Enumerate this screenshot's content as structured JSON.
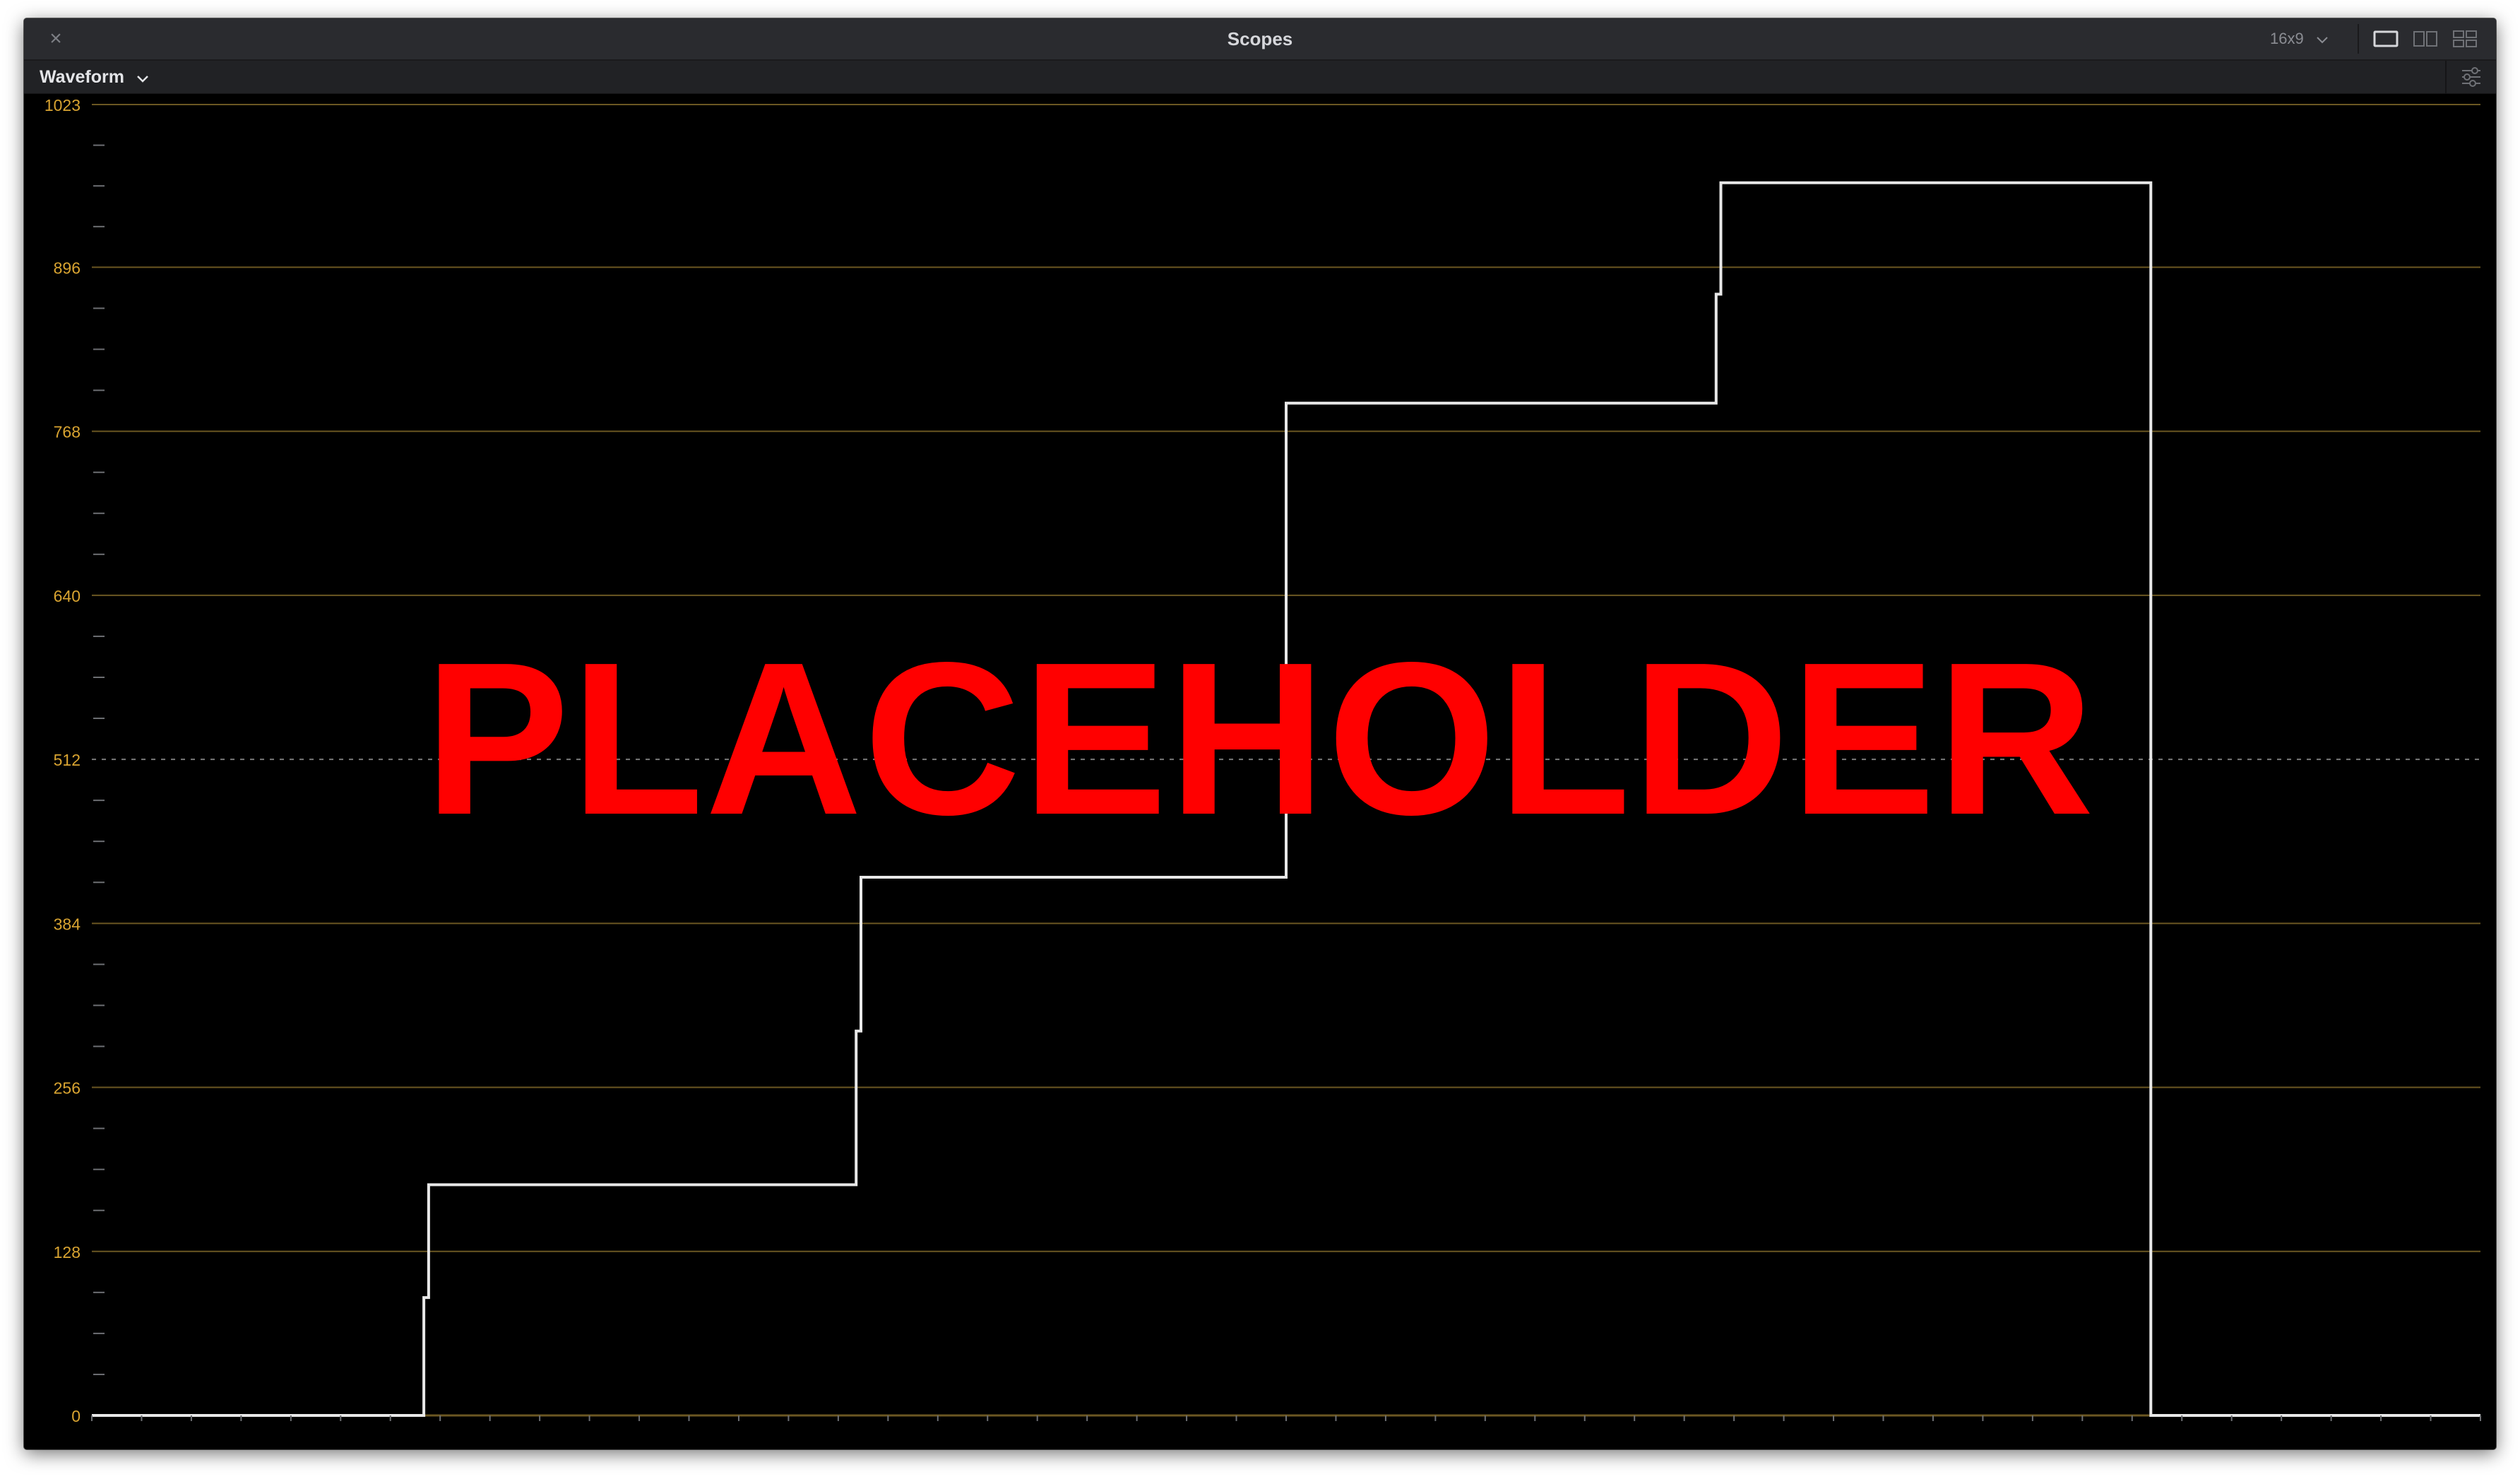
{
  "window": {
    "title": "Scopes",
    "close_glyph": "×",
    "aspect_ratio": "16x9",
    "layout_options": [
      "single-view-icon",
      "dual-view-icon",
      "quad-view-icon"
    ]
  },
  "toolbar": {
    "scope_type": "Waveform",
    "settings_icon": "sliders-icon"
  },
  "overlay": {
    "text": "PLACEHOLDER",
    "color": "#ff0000"
  },
  "colors": {
    "background": "#000000",
    "graticule": "#6b5722",
    "axis_label": "#d9a431",
    "trace": "#e8e8e8"
  },
  "chart_data": {
    "type": "line",
    "y_axis": {
      "ticks": [
        0,
        128,
        256,
        384,
        512,
        640,
        768,
        896,
        1023
      ],
      "labels": [
        "0",
        "128",
        "256",
        "384",
        "512",
        "640",
        "768",
        "896",
        "1023"
      ],
      "ylim": [
        0,
        1023
      ],
      "dashed_tick": 512
    },
    "xlim": [
      0,
      1
    ],
    "grid": true,
    "series": [
      {
        "points": [
          [
            0.0,
            0
          ],
          [
            0.139,
            0
          ],
          [
            0.139,
            92
          ],
          [
            0.141,
            92
          ],
          [
            0.141,
            180
          ],
          [
            0.32,
            180
          ],
          [
            0.32,
            300
          ],
          [
            0.322,
            300
          ],
          [
            0.322,
            420
          ],
          [
            0.5,
            420
          ],
          [
            0.5,
            790
          ],
          [
            0.68,
            790
          ],
          [
            0.68,
            875
          ],
          [
            0.682,
            875
          ],
          [
            0.682,
            962
          ],
          [
            0.862,
            962
          ],
          [
            0.862,
            0
          ],
          [
            1.0,
            0
          ]
        ]
      }
    ]
  }
}
